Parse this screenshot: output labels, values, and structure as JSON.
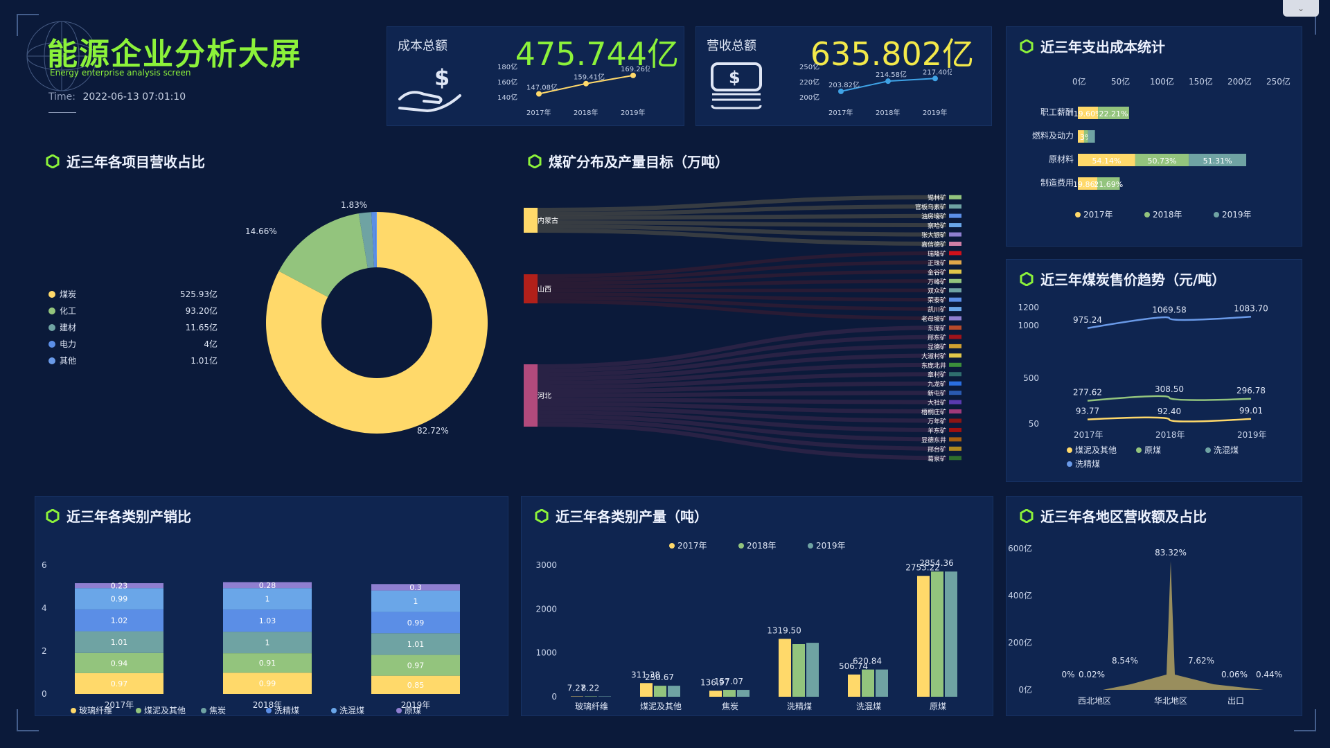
{
  "header": {
    "title": "能源企业分析大屏",
    "subtitle": "Energy enterprise analysis screen",
    "time_label": "Time:",
    "time_value": "2022-06-13 07:01:10"
  },
  "kpi_cost": {
    "label": "成本总额",
    "value": "475.744亿",
    "ticks": [
      "180亿",
      "160亿",
      "140亿"
    ],
    "years": [
      "2017年",
      "2018年",
      "2019年"
    ],
    "point_labels": [
      "147.08亿",
      "159.41亿",
      "169.26亿"
    ],
    "values": [
      147.08,
      159.41,
      169.26
    ],
    "color": "#ffd96a",
    "value_color": "#8cf23a"
  },
  "kpi_revenue": {
    "label": "营收总额",
    "value": "635.802亿",
    "ticks": [
      "250亿",
      "220亿",
      "200亿"
    ],
    "years": [
      "2017年",
      "2018年",
      "2019年"
    ],
    "point_labels": [
      "203.82亿",
      "214.58亿",
      "217.40亿"
    ],
    "values": [
      203.82,
      214.58,
      217.4
    ],
    "color": "#3fa3e6",
    "value_color": "#f3e94a"
  },
  "revenue_share": {
    "title": "近三年各项目营收占比",
    "legend": [
      {
        "name": "煤炭",
        "value": "525.93亿",
        "color": "#ffd96a"
      },
      {
        "name": "化工",
        "value": "93.20亿",
        "color": "#93c47d"
      },
      {
        "name": "建材",
        "value": "11.65亿",
        "color": "#6fa3a3"
      },
      {
        "name": "电力",
        "value": "4亿",
        "color": "#5b8ee6"
      },
      {
        "name": "其他",
        "value": "1.01亿",
        "color": "#6a9ae8"
      }
    ],
    "labels": {
      "big": "82.72%",
      "mid": "14.66%",
      "small": "1.83%"
    },
    "chart_data": {
      "type": "pie",
      "categories": [
        "煤炭",
        "化工",
        "建材",
        "电力",
        "其他"
      ],
      "values": [
        525.93,
        93.2,
        11.65,
        4,
        1.01
      ]
    }
  },
  "coal_mines": {
    "title": "煤矿分布及产量目标（万吨）",
    "sources": [
      {
        "name": "内蒙古",
        "color": "#ffd96a"
      },
      {
        "name": "山西",
        "color": "#b1201a"
      },
      {
        "name": "河北",
        "color": "#b24a7c"
      }
    ],
    "mines": [
      {
        "name": "锡林矿",
        "color": "#93c47d",
        "src": 0
      },
      {
        "name": "官板乌素矿",
        "color": "#6fa3a3",
        "src": 0
      },
      {
        "name": "油房壕矿",
        "color": "#5b8ee6",
        "src": 0
      },
      {
        "name": "察哈矿",
        "color": "#6aa6e8",
        "src": 0
      },
      {
        "name": "张大银矿",
        "color": "#8f7fd0",
        "src": 0
      },
      {
        "name": "嘉信德矿",
        "color": "#d07fa6",
        "src": 0
      },
      {
        "name": "瑞隆矿",
        "color": "#d0111b",
        "src": 1
      },
      {
        "name": "正珠矿",
        "color": "#e0a64a",
        "src": 1
      },
      {
        "name": "金谷矿",
        "color": "#e0c64a",
        "src": 1
      },
      {
        "name": "万峰矿",
        "color": "#93c47d",
        "src": 1
      },
      {
        "name": "双众矿",
        "color": "#6fa3a3",
        "src": 1
      },
      {
        "name": "荣泰矿",
        "color": "#5b8ee6",
        "src": 1
      },
      {
        "name": "凯川矿",
        "color": "#6aa6e8",
        "src": 1
      },
      {
        "name": "老母坡矿",
        "color": "#8f7fd0",
        "src": 1
      },
      {
        "name": "东庞矿",
        "color": "#b84a2a",
        "src": 2
      },
      {
        "name": "邢东矿",
        "color": "#a0131a",
        "src": 2
      },
      {
        "name": "显德矿",
        "color": "#d0a030",
        "src": 2
      },
      {
        "name": "大淑村矿",
        "color": "#e0c64a",
        "src": 2
      },
      {
        "name": "东庞北井",
        "color": "#3b8e3b",
        "src": 2
      },
      {
        "name": "章村矿",
        "color": "#2f6e6e",
        "src": 2
      },
      {
        "name": "九龙矿",
        "color": "#2a6ee0",
        "src": 2
      },
      {
        "name": "新屯矿",
        "color": "#2a5ab0",
        "src": 2
      },
      {
        "name": "大社矿",
        "color": "#5a3ab0",
        "src": 2
      },
      {
        "name": "梧桐庄矿",
        "color": "#a03a7a",
        "src": 2
      },
      {
        "name": "万年矿",
        "color": "#8a1515",
        "src": 2
      },
      {
        "name": "羊东矿",
        "color": "#a01010",
        "src": 2
      },
      {
        "name": "显德东井",
        "color": "#a86010",
        "src": 2
      },
      {
        "name": "邢台矿",
        "color": "#b08a20",
        "src": 2
      },
      {
        "name": "葛泉矿",
        "color": "#2e6e2e",
        "src": 2
      }
    ]
  },
  "expense_stats": {
    "title": "近三年支出成本统计",
    "xticks": [
      "0亿",
      "50亿",
      "100亿",
      "150亿",
      "200亿",
      "250亿"
    ],
    "categories": [
      "职工薪酬",
      "燃料及动力",
      "原材料",
      "制造费用"
    ],
    "series": [
      {
        "name": "2017年",
        "color": "#ffd96a",
        "values": [
          26,
          8,
          74,
          25
        ],
        "labels": [
          "19.60%",
          "",
          "54.14%",
          "19.86%"
        ]
      },
      {
        "name": "2018年",
        "color": "#93c47d",
        "values": [
          40,
          5,
          69,
          29
        ],
        "labels": [
          "22.21%",
          "3%",
          "50.73%",
          "21.69%"
        ]
      },
      {
        "name": "2019年",
        "color": "#6fa3a3",
        "values": [
          0,
          9,
          74,
          0
        ],
        "labels": [
          "",
          "",
          "51.31%",
          ""
        ]
      }
    ],
    "chart_data": {
      "type": "bar",
      "categories": [
        "职工薪酬",
        "燃料及动力",
        "原材料",
        "制造费用"
      ],
      "series": [
        {
          "name": "2017年",
          "values": [
            26,
            8,
            74,
            25
          ]
        },
        {
          "name": "2018年",
          "values": [
            40,
            5,
            69,
            29
          ]
        },
        {
          "name": "2019年",
          "values": [
            0,
            9,
            74,
            0
          ]
        }
      ],
      "xlim": [
        0,
        250
      ]
    }
  },
  "coal_price": {
    "title": "近三年煤炭售价趋势（元/吨）",
    "yticks": [
      "1200",
      "1000",
      "500",
      "50"
    ],
    "years": [
      "2017年",
      "2018年",
      "2019年"
    ],
    "series": [
      {
        "name": "煤泥及其他",
        "color": "#ffd96a",
        "values": [
          93.77,
          92.4,
          99.01
        ],
        "labels": [
          "93.77",
          "92.40",
          "99.01"
        ]
      },
      {
        "name": "原煤",
        "color": "#93c47d",
        "values": [
          277.62,
          308.5,
          296.78
        ],
        "labels": [
          "277.62",
          "308.50",
          "296.78"
        ]
      },
      {
        "name": "洗混煤",
        "color": "#6fa3a3",
        "values": [
          277.62,
          308.5,
          296.78
        ],
        "labels": []
      },
      {
        "name": "洗精煤",
        "color": "#6a9ae8",
        "values": [
          975.24,
          1069.58,
          1083.7
        ],
        "labels": [
          "975.24",
          "1069.58",
          "1083.70"
        ]
      }
    ],
    "legend": [
      "煤泥及其他",
      "原煤",
      "洗混煤",
      "洗精煤"
    ],
    "chart_data": {
      "type": "line",
      "x": [
        "2017年",
        "2018年",
        "2019年"
      ],
      "series": [
        {
          "name": "煤泥及其他",
          "values": [
            93.77,
            92.4,
            99.01
          ]
        },
        {
          "name": "原煤",
          "values": [
            277.62,
            308.5,
            296.78
          ]
        },
        {
          "name": "洗精煤",
          "values": [
            975.24,
            1069.58,
            1083.7
          ]
        }
      ]
    }
  },
  "prod_sales": {
    "title": "近三年各类别产销比",
    "yticks": [
      "6",
      "4",
      "2",
      "0"
    ],
    "years": [
      "2017年",
      "2018年",
      "2019年"
    ],
    "series": [
      {
        "name": "玻璃纤维",
        "color": "#ffd96a",
        "values": [
          0.97,
          0.99,
          0.85
        ]
      },
      {
        "name": "煤泥及其他",
        "color": "#93c47d",
        "values": [
          0.94,
          0.91,
          0.97
        ]
      },
      {
        "name": "焦炭",
        "color": "#6fa3a3",
        "values": [
          1.01,
          1,
          1.01
        ]
      },
      {
        "name": "洗精煤",
        "color": "#5b8ee6",
        "values": [
          1.02,
          1.03,
          0.99
        ]
      },
      {
        "name": "洗混煤",
        "color": "#6aa6e8",
        "values": [
          0.99,
          1,
          1
        ]
      },
      {
        "name": "原煤",
        "color": "#8f7fd0",
        "values": [
          0.23,
          0.28,
          0.3
        ]
      }
    ],
    "chart_data": {
      "type": "bar",
      "categories": [
        "2017年",
        "2018年",
        "2019年"
      ],
      "stacked": true,
      "ylim": [
        0,
        6
      ]
    }
  },
  "production": {
    "title": "近三年各类别产量（吨）",
    "legend": [
      "2017年",
      "2018年",
      "2019年"
    ],
    "colors": [
      "#ffd96a",
      "#93c47d",
      "#6fa3a3"
    ],
    "yticks": [
      "3000",
      "2000",
      "1000",
      "0"
    ],
    "categories": [
      "玻璃纤维",
      "煤泥及其他",
      "焦炭",
      "洗精煤",
      "洗混煤",
      "原煤"
    ],
    "values": [
      [
        7.27,
        8.22,
        8.0
      ],
      [
        311.38,
        250.67,
        250.67
      ],
      [
        136.97,
        157.07,
        157.07
      ],
      [
        1319.5,
        1200,
        1230
      ],
      [
        506.74,
        620.84,
        620.84
      ],
      [
        2753.22,
        2854.36,
        2854.36
      ]
    ],
    "labels": [
      [
        "7.27",
        "8.22",
        ""
      ],
      [
        "311.38",
        "250.67",
        ""
      ],
      [
        "136.97",
        "157.07",
        ""
      ],
      [
        "1319.50",
        "",
        ""
      ],
      [
        "506.74",
        "620.84",
        ""
      ],
      [
        "2753.22",
        "2854.36",
        ""
      ]
    ],
    "chart_data": {
      "type": "bar",
      "categories": [
        "玻璃纤维",
        "煤泥及其他",
        "焦炭",
        "洗精煤",
        "洗混煤",
        "原煤"
      ],
      "ylim": [
        0,
        3000
      ]
    }
  },
  "region": {
    "title": "近三年各地区营收额及占比",
    "yticks": [
      "600亿",
      "400亿",
      "200亿",
      "0亿"
    ],
    "xcats": [
      "西北地区",
      "华北地区",
      "出口"
    ],
    "pct_labels": [
      "0%",
      "0.02%",
      "8.54%",
      "83.32%",
      "7.62%",
      "0.06%",
      "0.44%"
    ],
    "color": "#a89a5e",
    "chart_data": {
      "type": "area",
      "x": [
        "西北地区",
        "华北地区",
        "出口"
      ],
      "values": [
        0.0,
        83.32,
        0.44
      ]
    }
  }
}
